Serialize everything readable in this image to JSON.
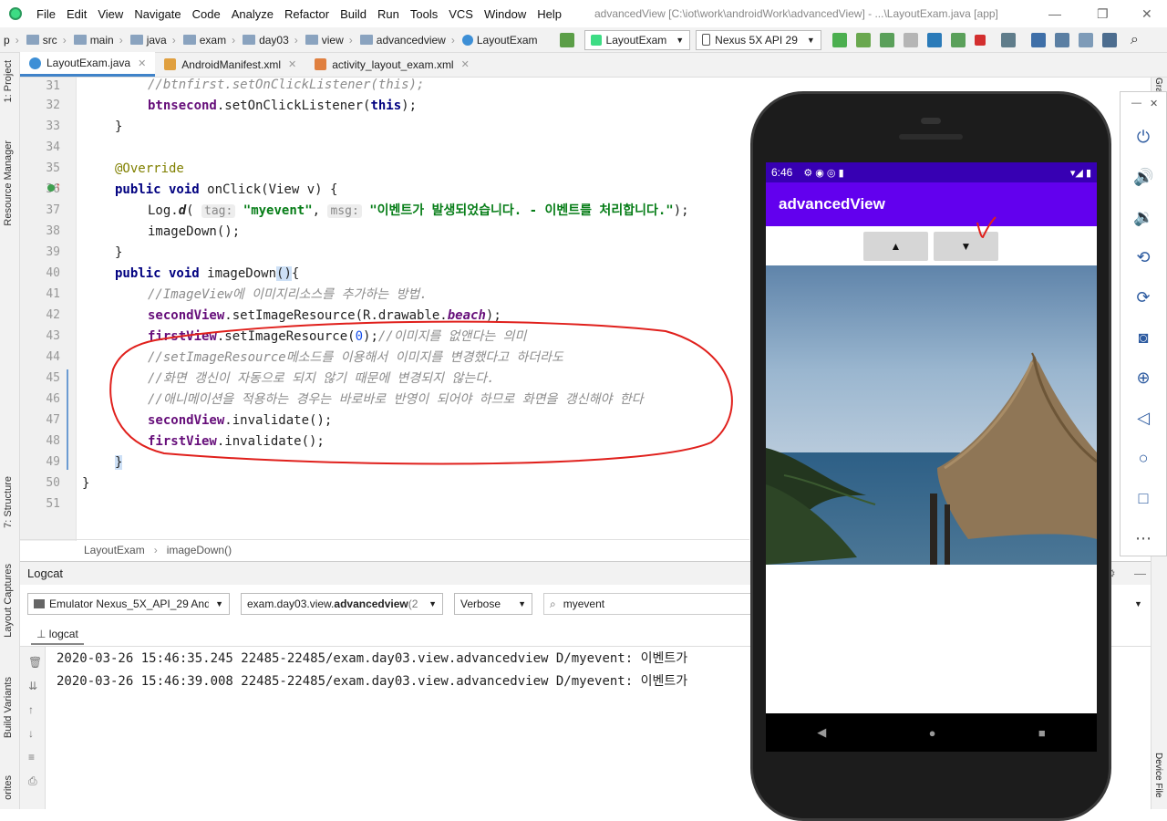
{
  "menubar": {
    "items": [
      "File",
      "Edit",
      "View",
      "Navigate",
      "Code",
      "Analyze",
      "Refactor",
      "Build",
      "Run",
      "Tools",
      "VCS",
      "Window",
      "Help"
    ],
    "title": "advancedView [C:\\iot\\work\\androidWork\\advancedView] - ...\\LayoutExam.java [app]"
  },
  "navbar": {
    "crumbs": [
      "p",
      "src",
      "main",
      "java",
      "exam",
      "day03",
      "view",
      "advancedview",
      "LayoutExam"
    ],
    "run_config": "LayoutExam",
    "device": "Nexus 5X API 29"
  },
  "left_strip": {
    "project": "1: Project",
    "resource_manager": "Resource Manager",
    "structure": "7: Structure",
    "layout_captures": "Layout Captures",
    "build_variants": "Build Variants",
    "favorites": "orites"
  },
  "tabs": [
    {
      "label": "LayoutExam.java"
    },
    {
      "label": "AndroidManifest.xml"
    },
    {
      "label": "activity_layout_exam.xml"
    }
  ],
  "editor": {
    "line_numbers": [
      "31",
      "32",
      "33",
      "34",
      "35",
      "36",
      "37",
      "38",
      "39",
      "40",
      "41",
      "42",
      "43",
      "44",
      "45",
      "46",
      "47",
      "48",
      "49",
      "50",
      "51"
    ],
    "lines": {
      "l31": "//btnfirst.setOnClickListener(this);",
      "l32a": "btnsecond",
      "l32b": ".setOnClickListener(",
      "l32c": "this",
      "l32d": ");",
      "l33": "}",
      "l35": "@Override",
      "l36a": "public void",
      "l36b": " onClick(View v) {",
      "l37a": "Log.",
      "l37b": "d",
      "l37c": "( ",
      "l37tag": "tag:",
      "l37d": " ",
      "l37e": "\"myevent\"",
      "l37f": ", ",
      "l37msg": "msg:",
      "l37g": " ",
      "l37h": "\"이벤트가 발생되었습니다. - 이벤트를 처리합니다.\"",
      "l37i": ");",
      "l38": "imageDown();",
      "l39": "}",
      "l40a": "public void",
      "l40b": " imageDown",
      "l40c": "()",
      "l40d": "{",
      "l41": "//ImageView에 이미지리소스를 추가하는 방법.",
      "l42a": "secondView",
      "l42b": ".setImageResource(R.drawable.",
      "l42c": "beach",
      "l42d": ");",
      "l43a": "firstView",
      "l43b": ".setImageResource(",
      "l43c": "0",
      "l43d": ");",
      "l43e": "//이미지를 없앤다는 의미",
      "l44": "//setImageResource메소드를 이용해서 이미지를 변경했다고 하더라도",
      "l45": "//화면 갱신이 자동으로 되지 않기 때문에 변경되지 않는다.",
      "l46": "//애니메이션을 적용하는 경우는 바로바로 반영이 되어야 하므로 화면을 갱신해야 한다",
      "l47a": "secondView",
      "l47b": ".invalidate();",
      "l48a": "firstView",
      "l48b": ".invalidate();",
      "l49": "}",
      "l50": "}"
    },
    "breadcrumb": {
      "cls": "LayoutExam",
      "method": "imageDown()"
    }
  },
  "logcat": {
    "title": "Logcat",
    "device": "Emulator Nexus_5X_API_29 Andı",
    "process_pre": "exam.day03.view.",
    "process_bold": "advancedview",
    "process_post": " (2",
    "level": "Verbose",
    "search": "myevent",
    "tab": "logcat",
    "lines": [
      "2020-03-26 15:46:35.245 22485-22485/exam.day03.view.advancedview D/myevent: 이벤트가",
      "2020-03-26 15:46:39.008 22485-22485/exam.day03.view.advancedview D/myevent: 이벤트가"
    ]
  },
  "right_strip": {
    "gradle": "Gra",
    "device_file": "Device File"
  },
  "phone": {
    "time": "6:46",
    "app_title": "advancedView",
    "btn_up": "▲",
    "btn_down": "▼"
  },
  "colors": {
    "status_bar": "#3700b3",
    "app_bar": "#6200ee",
    "annotation_red": "#e0201c",
    "keyword": "#000080",
    "string": "#067d17",
    "field": "#660e7a"
  }
}
